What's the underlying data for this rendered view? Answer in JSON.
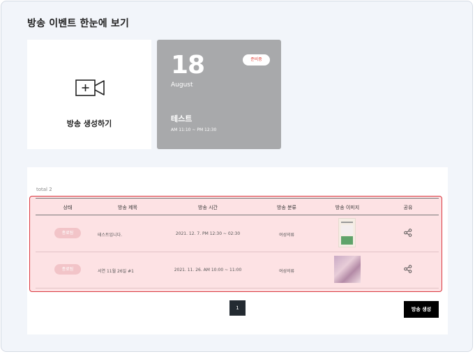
{
  "page": {
    "title": "방송 이벤트 한눈에 보기"
  },
  "create_card": {
    "label": "방송 생성하기",
    "icon": "video-plus-icon"
  },
  "event_card": {
    "day": "18",
    "month": "August",
    "badge": "준비중",
    "title": "테스트",
    "time": "AM 11:10 ~ PM 12:30",
    "background": "#a8a9ab"
  },
  "list": {
    "total_label": "total 2",
    "columns": [
      "상태",
      "방송 제목",
      "방송 시간",
      "방송 분류",
      "방송 이미지",
      "공유"
    ],
    "rows": [
      {
        "status": "종료됨",
        "title": "테스트입니다.",
        "time": "2021. 12. 7. PM 12:30 ~ 02:30",
        "category": "여성의류",
        "image": "thumbnail-1",
        "share_icon": "share-icon"
      },
      {
        "status": "종료됨",
        "title": "서연 11월 26일 #1",
        "time": "2021. 11. 26. AM 10:00 ~ 11:00",
        "category": "여성의류",
        "image": "thumbnail-2",
        "share_icon": "share-icon"
      }
    ],
    "highlight_color": "#d9363e"
  },
  "pagination": {
    "current": "1"
  },
  "create_button": {
    "label": "방송 생성"
  }
}
